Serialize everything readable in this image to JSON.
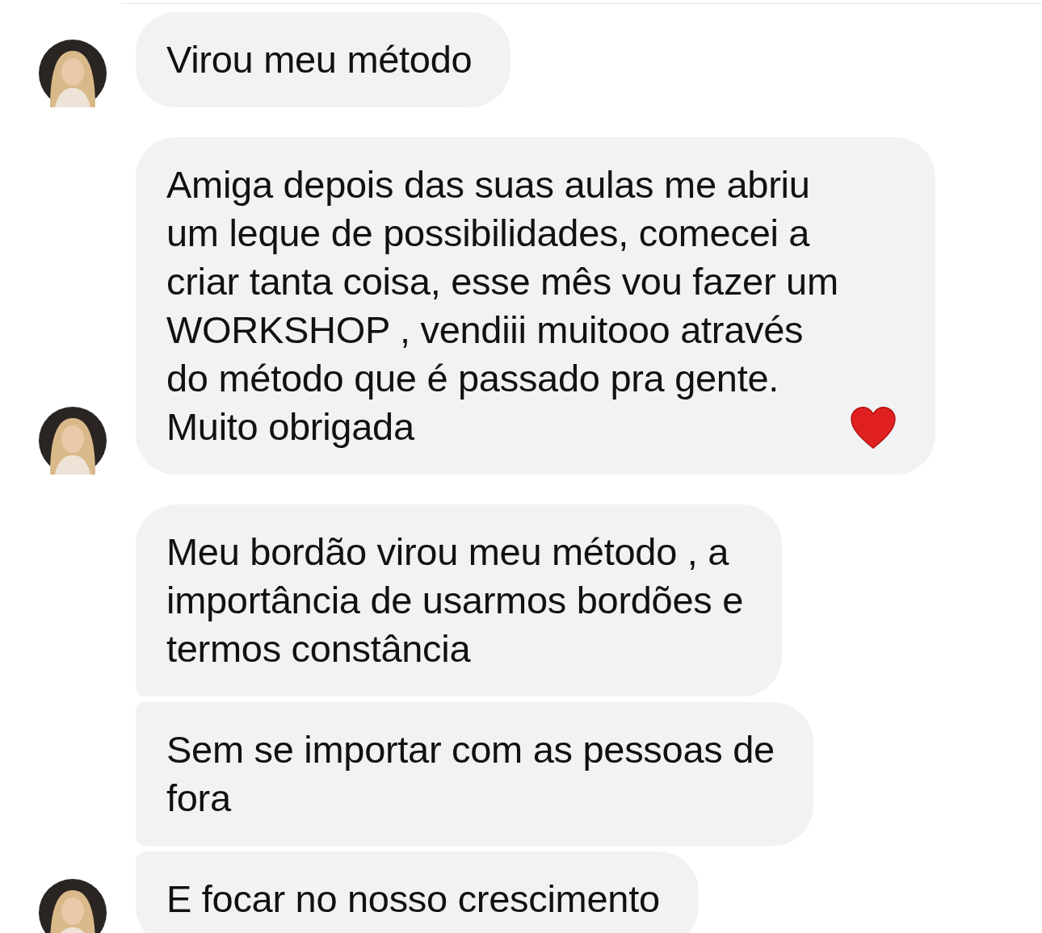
{
  "messages": [
    {
      "text": "Virou meu método",
      "avatar": true,
      "heart": false
    },
    {
      "text": "Amiga depois das suas aulas me abriu\num leque de possibilidades, comecei a\ncriar tanta coisa, esse mês vou fazer um\nWORKSHOP , vendiii muitooo através\ndo método que é passado pra gente.\nMuito obrigada",
      "avatar": true,
      "heart": true
    },
    {
      "text": "Meu bordão virou meu método , a\nimportância de usarmos bordões e\ntermos constância",
      "avatar": false,
      "heart": false
    },
    {
      "text": "Sem se importar com as pessoas de\nfora",
      "avatar": false,
      "heart": false
    },
    {
      "text": "E focar no nosso crescimento",
      "avatar": true,
      "heart": false
    }
  ]
}
